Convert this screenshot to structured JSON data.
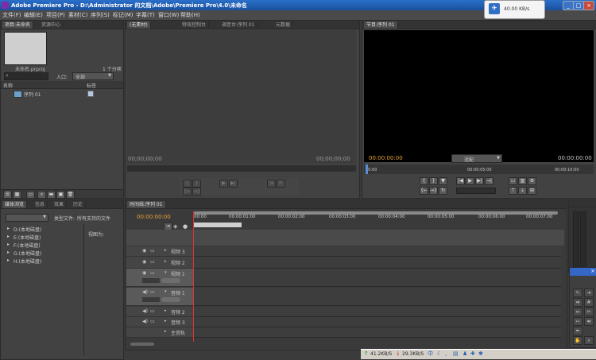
{
  "title_bar": {
    "title": "Adobe Premiere Pro - D:\\Administrator 的文档\\Adobe\\Premiere Pro\\4.0\\未命名"
  },
  "window_controls": {
    "minimize": "_",
    "maximize": "□",
    "close": "×"
  },
  "network": {
    "speed": "40.00 KB/s"
  },
  "menu": [
    "文件(F)",
    "编辑(E)",
    "项目(P)",
    "素材(C)",
    "序列(S)",
    "标记(M)",
    "字幕(T)",
    "窗口(W)",
    "帮助(H)"
  ],
  "project_panel": {
    "tabs": [
      "项目:未命名",
      "资源中心"
    ],
    "file_name": "未命名.prproj",
    "item_count": "1 个分项",
    "entry_label": "入口:",
    "entry_value": "全部",
    "col_name": "名称",
    "col_label": "标签",
    "items": [
      {
        "name": "序列 01"
      }
    ]
  },
  "source_monitor": {
    "tabs": [
      "(无素材)",
      "特效控制台",
      "调音台:序列 01",
      "元数据"
    ],
    "tc_left": "00;00;00;00",
    "tc_right": "00;00;00;00"
  },
  "program_monitor": {
    "tab": "节目:序列 01",
    "tc_current": "00:00:00:00",
    "fit": "适配",
    "tc_total": "00:00:00:00",
    "ruler_left": "00:00",
    "ruler_mid": "00:00:05:00",
    "ruler_right": "00:00:10:00"
  },
  "media_browser": {
    "tabs": [
      "媒体浏览",
      "信息",
      "效果",
      "历史"
    ],
    "file_type_label": "类型文件:",
    "file_type_value": "所有支持的文件",
    "view_as_label": "视图为:",
    "drives": [
      "D:(本地磁盘)",
      "E:(本地磁盘)",
      "F:(本地磁盘)",
      "G:(本地磁盘)",
      "H:(本地磁盘)"
    ]
  },
  "timeline": {
    "tab": "时间线:序列 01",
    "tc": "00:00:00:00",
    "ruler": [
      "00:00",
      "00:00:01:00",
      "00:00:02:00",
      "00:00:03:00",
      "00:00:04:00",
      "00:00:05:00",
      "00:00:06:00",
      "00:00:07:00"
    ],
    "video_tracks": [
      "视频 3",
      "视频 2",
      "视频 1"
    ],
    "audio_tracks": [
      "音频 1",
      "音频 2",
      "音频 3",
      "主音轨"
    ]
  },
  "status_bar": {
    "left_rate": "41.2KB/S",
    "right_rate": "29.3KB/S"
  }
}
